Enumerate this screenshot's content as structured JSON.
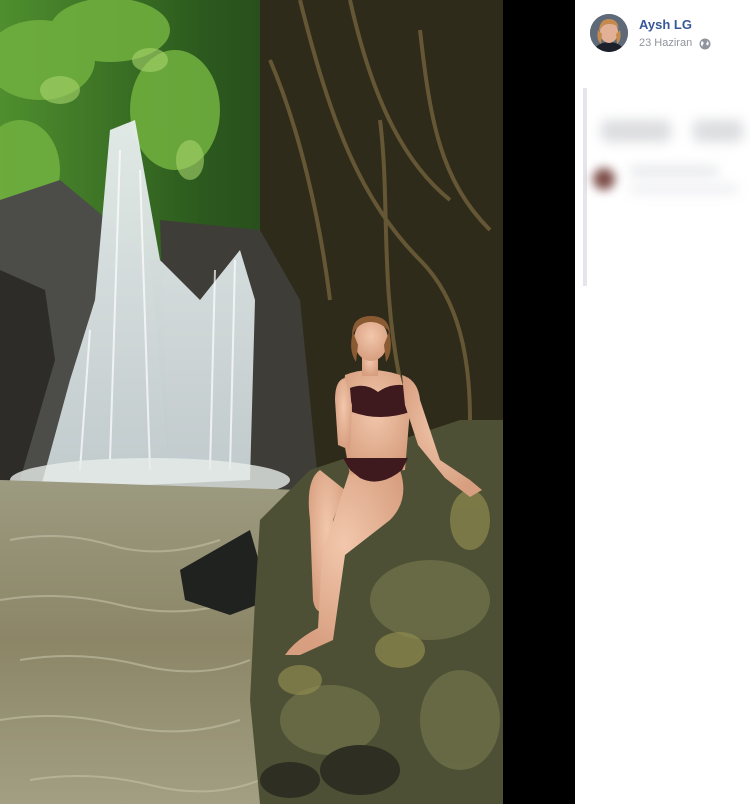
{
  "post": {
    "author_name": "Aysh LG",
    "date": "23 Haziran",
    "separator": "·",
    "privacy_icon": "globe-icon",
    "avatar_icon": "avatar"
  },
  "photo": {
    "description_icon": "photo-waterfall"
  },
  "colors": {
    "viewer_bg": "#000000",
    "name_link": "#365899",
    "meta_text": "#90949c"
  }
}
